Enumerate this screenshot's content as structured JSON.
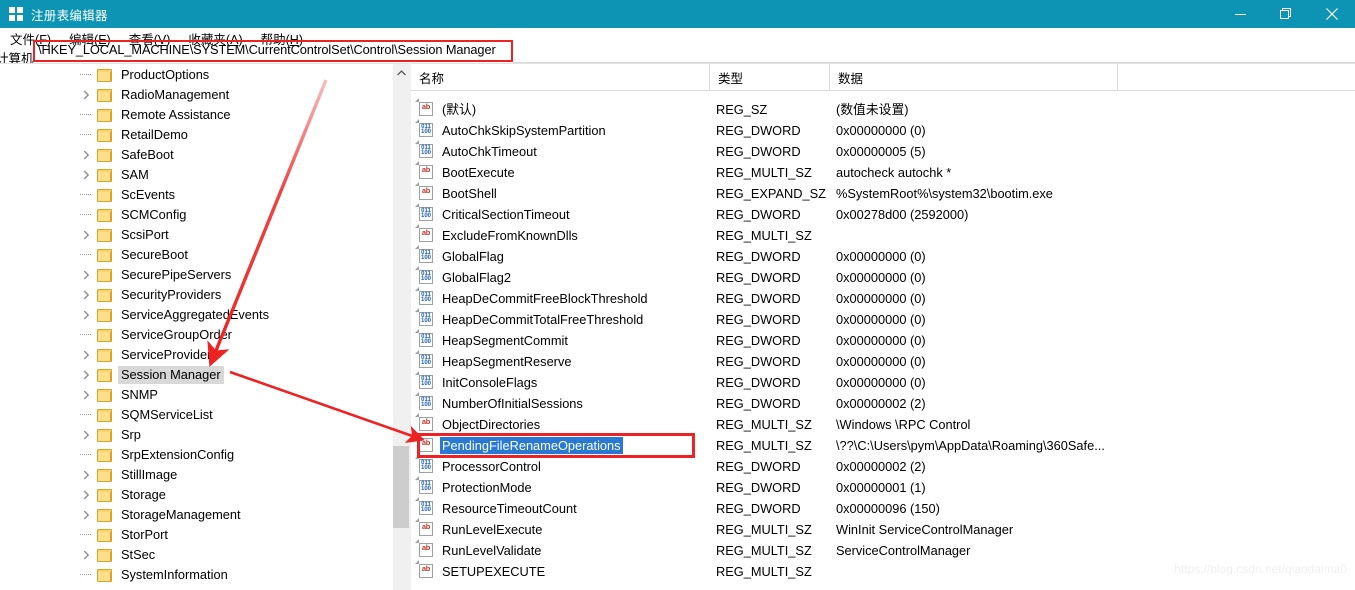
{
  "window": {
    "title": "注册表编辑器",
    "icon": "registry-icon",
    "accent_color": "#0d94b4",
    "controls": {
      "minimize": "—",
      "maximize": "❐",
      "close": "✕"
    }
  },
  "menu": {
    "items": [
      {
        "label": "文件(F)",
        "text": "文件",
        "key": "F"
      },
      {
        "label": "编辑(E)",
        "text": "编辑",
        "key": "E"
      },
      {
        "label": "查看(V)",
        "text": "查看",
        "key": "V"
      },
      {
        "label": "收藏夹(A)",
        "text": "收藏夹",
        "key": "A"
      },
      {
        "label": "帮助(H)",
        "text": "帮助",
        "key": "H"
      }
    ]
  },
  "address_bar": {
    "prefix": "计算机",
    "path": "\\HKEY_LOCAL_MACHINE\\SYSTEM\\CurrentControlSet\\Control\\Session Manager",
    "highlight_color": "#ee2222"
  },
  "tree": {
    "selected": "Session Manager",
    "scrollbar": {
      "up_arrow": "chevron-up",
      "thumb_visible": true
    },
    "items": [
      {
        "label": "ProductOptions",
        "expandable": false
      },
      {
        "label": "RadioManagement",
        "expandable": true
      },
      {
        "label": "Remote Assistance",
        "expandable": false
      },
      {
        "label": "RetailDemo",
        "expandable": false
      },
      {
        "label": "SafeBoot",
        "expandable": true
      },
      {
        "label": "SAM",
        "expandable": true
      },
      {
        "label": "ScEvents",
        "expandable": false
      },
      {
        "label": "SCMConfig",
        "expandable": false
      },
      {
        "label": "ScsiPort",
        "expandable": true
      },
      {
        "label": "SecureBoot",
        "expandable": false
      },
      {
        "label": "SecurePipeServers",
        "expandable": true
      },
      {
        "label": "SecurityProviders",
        "expandable": true
      },
      {
        "label": "ServiceAggregatedEvents",
        "expandable": true
      },
      {
        "label": "ServiceGroupOrder",
        "expandable": false
      },
      {
        "label": "ServiceProvider",
        "expandable": true
      },
      {
        "label": "Session Manager",
        "expandable": true,
        "selected": true
      },
      {
        "label": "SNMP",
        "expandable": true
      },
      {
        "label": "SQMServiceList",
        "expandable": false
      },
      {
        "label": "Srp",
        "expandable": true
      },
      {
        "label": "SrpExtensionConfig",
        "expandable": false
      },
      {
        "label": "StillImage",
        "expandable": true
      },
      {
        "label": "Storage",
        "expandable": true
      },
      {
        "label": "StorageManagement",
        "expandable": true
      },
      {
        "label": "StorPort",
        "expandable": false
      },
      {
        "label": "StSec",
        "expandable": true
      },
      {
        "label": "SystemInformation",
        "expandable": false
      },
      {
        "label": "",
        "expandable": false
      }
    ]
  },
  "value_list": {
    "columns": [
      {
        "label": "名称"
      },
      {
        "label": "类型"
      },
      {
        "label": "数据"
      }
    ],
    "selected": "PendingFileRenameOperations",
    "rows": [
      {
        "icon": "string-value-icon",
        "name": "(默认)",
        "type": "REG_SZ",
        "data": "(数值未设置)"
      },
      {
        "icon": "dword-value-icon",
        "name": "AutoChkSkipSystemPartition",
        "type": "REG_DWORD",
        "data": "0x00000000 (0)"
      },
      {
        "icon": "dword-value-icon",
        "name": "AutoChkTimeout",
        "type": "REG_DWORD",
        "data": "0x00000005 (5)"
      },
      {
        "icon": "string-value-icon",
        "name": "BootExecute",
        "type": "REG_MULTI_SZ",
        "data": "autocheck autochk *"
      },
      {
        "icon": "string-value-icon",
        "name": "BootShell",
        "type": "REG_EXPAND_SZ",
        "data": "%SystemRoot%\\system32\\bootim.exe"
      },
      {
        "icon": "dword-value-icon",
        "name": "CriticalSectionTimeout",
        "type": "REG_DWORD",
        "data": "0x00278d00 (2592000)"
      },
      {
        "icon": "string-value-icon",
        "name": "ExcludeFromKnownDlls",
        "type": "REG_MULTI_SZ",
        "data": ""
      },
      {
        "icon": "dword-value-icon",
        "name": "GlobalFlag",
        "type": "REG_DWORD",
        "data": "0x00000000 (0)"
      },
      {
        "icon": "dword-value-icon",
        "name": "GlobalFlag2",
        "type": "REG_DWORD",
        "data": "0x00000000 (0)"
      },
      {
        "icon": "dword-value-icon",
        "name": "HeapDeCommitFreeBlockThreshold",
        "type": "REG_DWORD",
        "data": "0x00000000 (0)"
      },
      {
        "icon": "dword-value-icon",
        "name": "HeapDeCommitTotalFreeThreshold",
        "type": "REG_DWORD",
        "data": "0x00000000 (0)"
      },
      {
        "icon": "dword-value-icon",
        "name": "HeapSegmentCommit",
        "type": "REG_DWORD",
        "data": "0x00000000 (0)"
      },
      {
        "icon": "dword-value-icon",
        "name": "HeapSegmentReserve",
        "type": "REG_DWORD",
        "data": "0x00000000 (0)"
      },
      {
        "icon": "dword-value-icon",
        "name": "InitConsoleFlags",
        "type": "REG_DWORD",
        "data": "0x00000000 (0)"
      },
      {
        "icon": "dword-value-icon",
        "name": "NumberOfInitialSessions",
        "type": "REG_DWORD",
        "data": "0x00000002 (2)"
      },
      {
        "icon": "string-value-icon",
        "name": "ObjectDirectories",
        "type": "REG_MULTI_SZ",
        "data": "\\Windows \\RPC Control"
      },
      {
        "icon": "string-value-icon",
        "name": "PendingFileRenameOperations",
        "type": "REG_MULTI_SZ",
        "data": "\\??\\C:\\Users\\pym\\AppData\\Roaming\\360Safe...",
        "selected": true
      },
      {
        "icon": "dword-value-icon",
        "name": "ProcessorControl",
        "type": "REG_DWORD",
        "data": "0x00000002 (2)"
      },
      {
        "icon": "dword-value-icon",
        "name": "ProtectionMode",
        "type": "REG_DWORD",
        "data": "0x00000001 (1)"
      },
      {
        "icon": "dword-value-icon",
        "name": "ResourceTimeoutCount",
        "type": "REG_DWORD",
        "data": "0x00000096 (150)"
      },
      {
        "icon": "string-value-icon",
        "name": "RunLevelExecute",
        "type": "REG_MULTI_SZ",
        "data": "WinInit ServiceControlManager"
      },
      {
        "icon": "string-value-icon",
        "name": "RunLevelValidate",
        "type": "REG_MULTI_SZ",
        "data": "ServiceControlManager"
      },
      {
        "icon": "string-value-icon",
        "name": "SETUPEXECUTE",
        "type": "REG_MULTI_SZ",
        "data": ""
      }
    ]
  },
  "annotations": {
    "color": "#ee2222",
    "arrows": [
      {
        "name": "arrow-to-session-manager"
      },
      {
        "name": "arrow-to-pending-file-rename"
      }
    ]
  },
  "watermark": {
    "text": "https://blog.csdn.net/qiaodaima0"
  }
}
